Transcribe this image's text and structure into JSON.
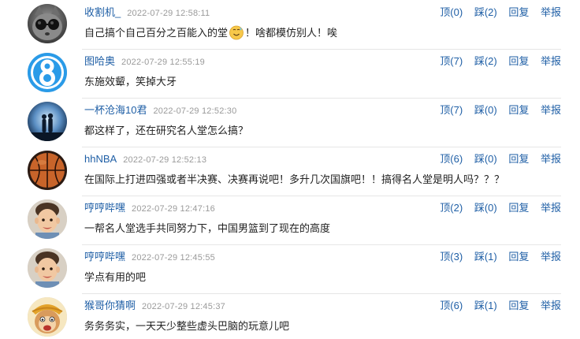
{
  "actions": {
    "up_label": "顶",
    "down_label": "踩",
    "reply_label": "回复",
    "report_label": "举报"
  },
  "comments": [
    {
      "avatar_icon": "cat-sunglasses-avatar",
      "username": "收割机_",
      "time": "2022-07-29 12:58:11",
      "up": "(0)",
      "down": "(2)",
      "text_before": "自己搞个自己百分之百能入的堂",
      "emoji": "sweat-smile-emoji",
      "text_after": "！啥都模仿别人！唉"
    },
    {
      "avatar_icon": "number-eight-avatar",
      "username": "图哈奥",
      "time": "2022-07-29 12:55:19",
      "up": "(7)",
      "down": "(2)",
      "text": "东施效颦，笑掉大牙"
    },
    {
      "avatar_icon": "couple-sunset-avatar",
      "username": "一杯沧海10君",
      "time": "2022-07-29 12:52:30",
      "up": "(7)",
      "down": "(0)",
      "text": "都这样了，还在研究名人堂怎么搞？"
    },
    {
      "avatar_icon": "basketball-avatar",
      "username": "hhNBA",
      "time": "2022-07-29 12:52:13",
      "up": "(6)",
      "down": "(0)",
      "text": "在国际上打进四强或者半决赛、决赛再说吧！多升几次国旗吧！！搞得名人堂是明人吗？？？"
    },
    {
      "avatar_icon": "child-photo-avatar",
      "username": "哼哼哔嘿",
      "time": "2022-07-29 12:47:16",
      "up": "(2)",
      "down": "(0)",
      "text": "一帮名人堂选手共同努力下，中国男篮到了现在的高度"
    },
    {
      "avatar_icon": "child-photo-avatar",
      "username": "哼哼哔嘿",
      "time": "2022-07-29 12:45:55",
      "up": "(3)",
      "down": "(1)",
      "text": "学点有用的吧"
    },
    {
      "avatar_icon": "cartoon-monkey-avatar",
      "username": "猴哥你猜啊",
      "time": "2022-07-29 12:45:37",
      "up": "(6)",
      "down": "(1)",
      "text": "务务务实，一天天少整些虚头巴脑的玩意儿吧"
    }
  ]
}
